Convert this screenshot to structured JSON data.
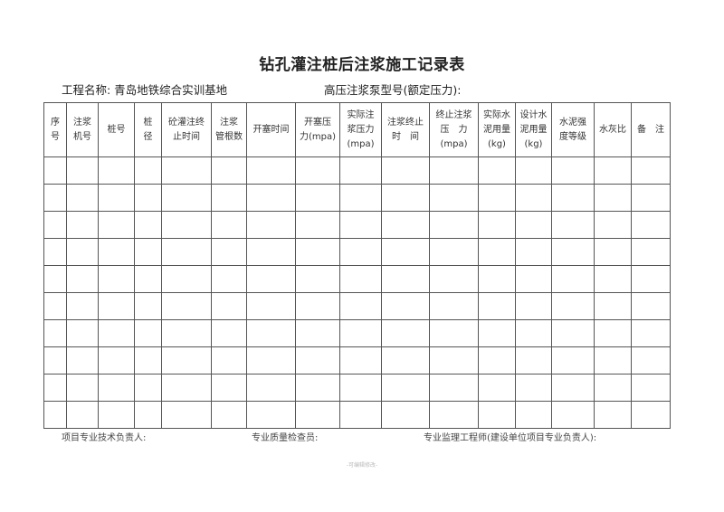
{
  "document": {
    "title": "钻孔灌注桩后注浆施工记录表",
    "project_label": "工程名称: 青岛地铁综合实训基地",
    "pump_label": "高压注浆泵型号(额定压力):"
  },
  "table": {
    "headers": [
      [
        "序",
        "号"
      ],
      [
        "注浆",
        "机号"
      ],
      [
        "桩号"
      ],
      [
        "桩",
        "径"
      ],
      [
        "砼灌注终",
        "止时间"
      ],
      [
        "注浆",
        "管根数"
      ],
      [
        "开塞时间"
      ],
      [
        "开塞压",
        "力(mpa)"
      ],
      [
        "实际注",
        "浆压力",
        "(mpa)"
      ],
      [
        "注浆终止",
        "时　间"
      ],
      [
        "终止注浆",
        "压　力",
        "(mpa)"
      ],
      [
        "实际水",
        "泥用量",
        "(kg)"
      ],
      [
        "设计水",
        "泥用量",
        "(kg)"
      ],
      [
        "水泥强",
        "度等级"
      ],
      [
        "水灰比"
      ],
      [
        "备　注"
      ]
    ],
    "rows": [
      [
        "",
        "",
        "",
        "",
        "",
        "",
        "",
        "",
        "",
        "",
        "",
        "",
        "",
        "",
        "",
        ""
      ],
      [
        "",
        "",
        "",
        "",
        "",
        "",
        "",
        "",
        "",
        "",
        "",
        "",
        "",
        "",
        "",
        ""
      ],
      [
        "",
        "",
        "",
        "",
        "",
        "",
        "",
        "",
        "",
        "",
        "",
        "",
        "",
        "",
        "",
        ""
      ],
      [
        "",
        "",
        "",
        "",
        "",
        "",
        "",
        "",
        "",
        "",
        "",
        "",
        "",
        "",
        "",
        ""
      ],
      [
        "",
        "",
        "",
        "",
        "",
        "",
        "",
        "",
        "",
        "",
        "",
        "",
        "",
        "",
        "",
        ""
      ],
      [
        "",
        "",
        "",
        "",
        "",
        "",
        "",
        "",
        "",
        "",
        "",
        "",
        "",
        "",
        "",
        ""
      ],
      [
        "",
        "",
        "",
        "",
        "",
        "",
        "",
        "",
        "",
        "",
        "",
        "",
        "",
        "",
        "",
        ""
      ],
      [
        "",
        "",
        "",
        "",
        "",
        "",
        "",
        "",
        "",
        "",
        "",
        "",
        "",
        "",
        "",
        ""
      ],
      [
        "",
        "",
        "",
        "",
        "",
        "",
        "",
        "",
        "",
        "",
        "",
        "",
        "",
        "",
        "",
        ""
      ],
      [
        "",
        "",
        "",
        "",
        "",
        "",
        "",
        "",
        "",
        "",
        "",
        "",
        "",
        "",
        "",
        ""
      ]
    ]
  },
  "footer": {
    "technical_lead": "项目专业技术负责人:",
    "quality_inspector": "专业质量检查员:",
    "supervisor": "专业监理工程师(建设单位项目专业负责人):",
    "watermark": "-可编辑修改-"
  }
}
